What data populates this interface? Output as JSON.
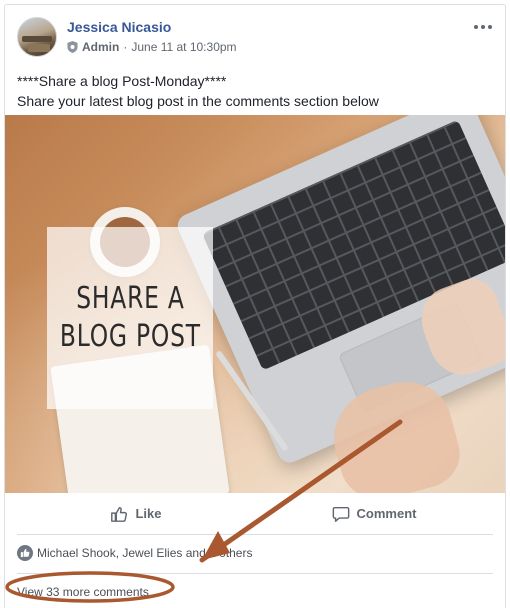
{
  "post": {
    "author": "Jessica Nicasio",
    "role": "Admin",
    "separator": "·",
    "timestamp": "June 11 at 10:30pm",
    "text_line1": "****Share a blog Post-Monday****",
    "text_line2": "Share your latest blog post in the comments section below"
  },
  "image": {
    "overlay_line1": "SHARE A",
    "overlay_line2": "BLOG POST"
  },
  "actions": {
    "like_label": "Like",
    "comment_label": "Comment"
  },
  "reactions": {
    "text": "Michael Shook, Jewel Elies and 2 others"
  },
  "comments": {
    "view_more_label": "View 33 more comments"
  },
  "colors": {
    "author_link": "#385898",
    "annotation": "#a9582f",
    "muted_text": "#606770"
  },
  "icons": [
    "more-options-icon",
    "admin-shield-icon",
    "like-thumb-icon",
    "comment-bubble-icon",
    "reaction-like-icon"
  ]
}
